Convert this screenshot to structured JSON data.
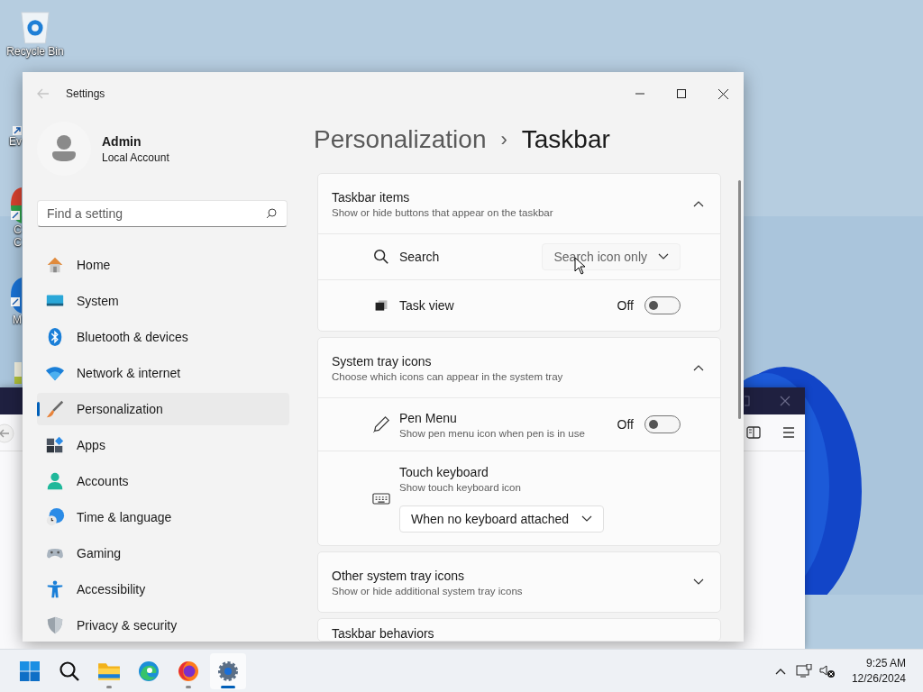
{
  "desktop_icons": [
    {
      "kind": "recycle-bin",
      "label": "Recycle Bin"
    },
    {
      "kind": "shortcut",
      "label": "Ev"
    },
    {
      "kind": "round-red-green",
      "label": "C\nC"
    },
    {
      "kind": "round-blue",
      "label": "M"
    },
    {
      "kind": "file"
    }
  ],
  "settings": {
    "title": "Settings",
    "user": {
      "name": "Admin",
      "account": "Local Account"
    },
    "search": {
      "placeholder": "Find a setting"
    },
    "nav": [
      {
        "kind": "home",
        "label": "Home",
        "selected": false
      },
      {
        "kind": "system",
        "label": "System",
        "selected": false
      },
      {
        "kind": "bluetooth",
        "label": "Bluetooth & devices",
        "selected": false
      },
      {
        "kind": "network",
        "label": "Network & internet",
        "selected": false
      },
      {
        "kind": "personalization",
        "label": "Personalization",
        "selected": true
      },
      {
        "kind": "apps",
        "label": "Apps",
        "selected": false
      },
      {
        "kind": "accounts",
        "label": "Accounts",
        "selected": false
      },
      {
        "kind": "time",
        "label": "Time & language",
        "selected": false
      },
      {
        "kind": "gaming",
        "label": "Gaming",
        "selected": false
      },
      {
        "kind": "accessibility",
        "label": "Accessibility",
        "selected": false
      },
      {
        "kind": "privacy",
        "label": "Privacy & security",
        "selected": false
      }
    ],
    "breadcrumb": {
      "parent": "Personalization",
      "separator": "›",
      "current": "Taskbar"
    },
    "sections": [
      {
        "title": "Taskbar items",
        "subtitle": "Show or hide buttons that appear on the taskbar",
        "expanded": true,
        "items": [
          {
            "kind": "dropdown",
            "label": "Search",
            "value": "Search icon only"
          },
          {
            "kind": "toggle",
            "label": "Task view",
            "state": "Off",
            "on": false
          }
        ]
      },
      {
        "title": "System tray icons",
        "subtitle": "Choose which icons can appear in the system tray",
        "expanded": true,
        "items": [
          {
            "kind": "toggle",
            "label": "Pen Menu",
            "description": "Show pen menu icon when pen is in use",
            "state": "Off",
            "on": false
          },
          {
            "kind": "dropdown-below",
            "label": "Touch keyboard",
            "description": "Show touch keyboard icon",
            "value": "When no keyboard attached"
          }
        ]
      },
      {
        "title": "Other system tray icons",
        "subtitle": "Show or hide additional system tray icons",
        "expanded": false
      },
      {
        "title": "Taskbar behaviors"
      }
    ]
  },
  "taskbar": {
    "apps": [
      {
        "kind": "start",
        "running": false,
        "selected": false
      },
      {
        "kind": "search",
        "running": false,
        "selected": false
      },
      {
        "kind": "explorer",
        "running": true,
        "selected": false
      },
      {
        "kind": "edge",
        "running": false,
        "selected": false
      },
      {
        "kind": "firefox",
        "running": true,
        "selected": false
      },
      {
        "kind": "settings",
        "running": true,
        "selected": true
      }
    ],
    "time": "9:25 AM",
    "date": "12/26/2024"
  }
}
